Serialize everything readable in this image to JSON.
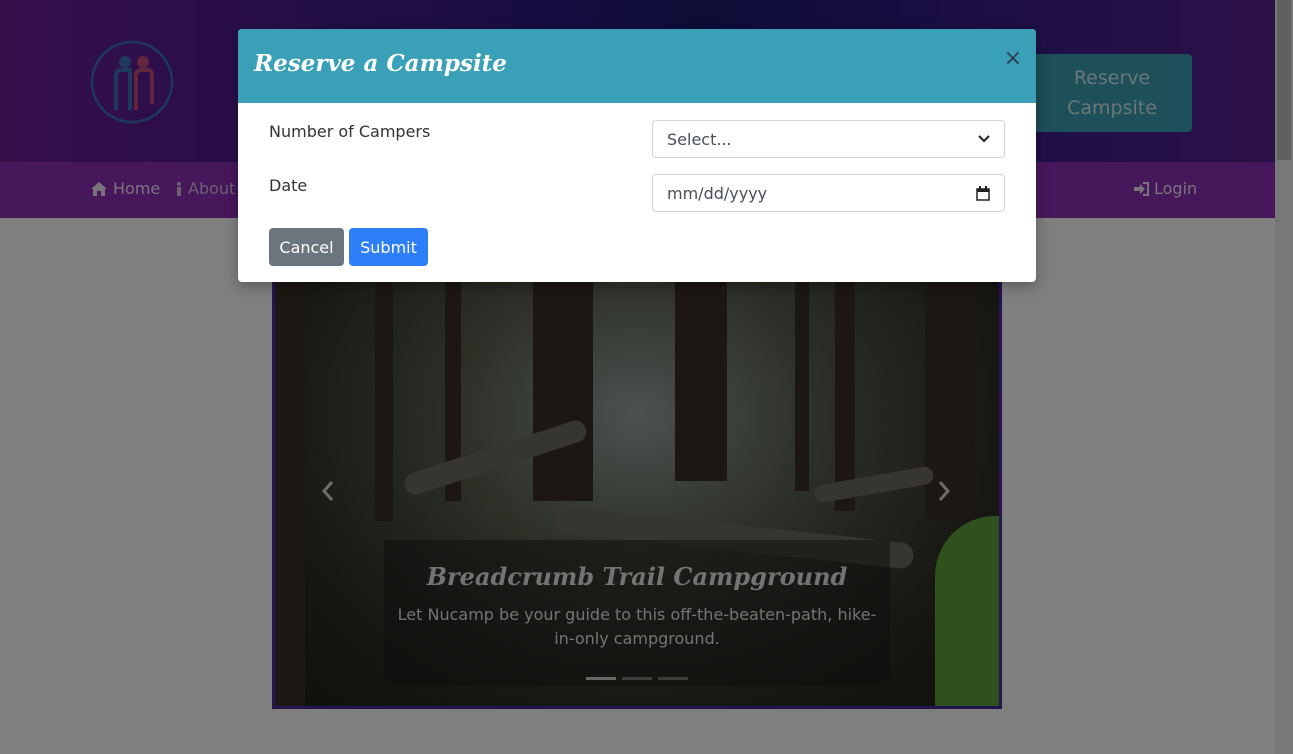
{
  "header": {
    "reserve_button": "Reserve Campsite"
  },
  "nav": {
    "home": "Home",
    "about": "About",
    "login": "Login"
  },
  "carousel": {
    "caption_title": "Breadcrumb Trail Campground",
    "caption_text": "Let Nucamp be your guide to this off-the-beaten-path, hike-in-only campground.",
    "slide_count": 3,
    "active_slide": 1
  },
  "modal": {
    "title": "Reserve a Campsite",
    "close": "×",
    "campers_label": "Number of Campers",
    "campers_value": "Select...",
    "date_label": "Date",
    "date_placeholder": "mm/dd/yyyy",
    "cancel": "Cancel",
    "submit": "Submit"
  },
  "colors": {
    "modal_header": "#3aa0b8",
    "submit": "#2d7ff9",
    "cancel": "#6c757d",
    "navbar": "#8e2eb8"
  },
  "icons": [
    "home-icon",
    "info-icon",
    "login-icon",
    "close-icon",
    "chevron-down-icon",
    "calendar-icon",
    "chevron-left-icon",
    "chevron-right-icon"
  ]
}
